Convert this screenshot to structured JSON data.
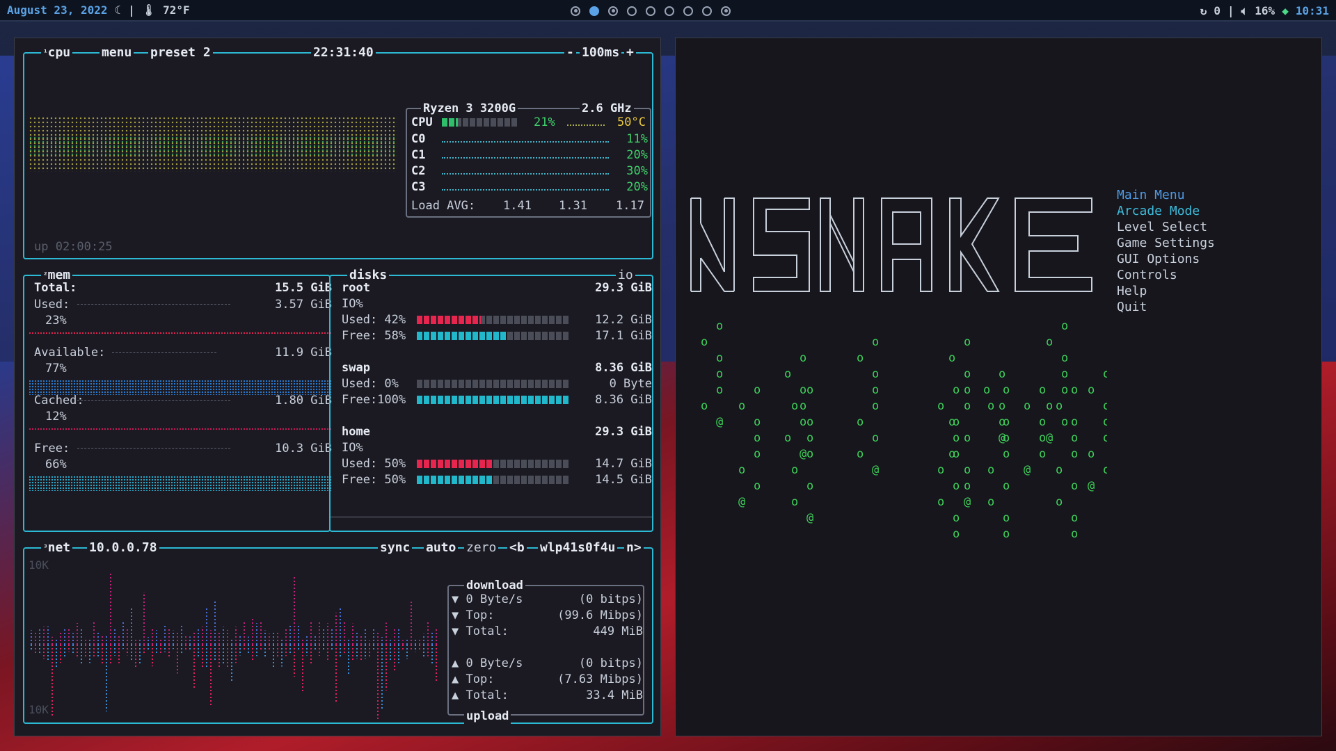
{
  "topbar": {
    "date": "August 23, 2022",
    "moon_icon": "moon-icon",
    "temp_icon": "thermometer-icon",
    "temperature": "72°F",
    "workspaces": [
      {
        "state": "dot"
      },
      {
        "state": "active"
      },
      {
        "state": "dot"
      },
      {
        "state": "empty"
      },
      {
        "state": "empty"
      },
      {
        "state": "empty"
      },
      {
        "state": "empty"
      },
      {
        "state": "empty"
      },
      {
        "state": "dot"
      }
    ],
    "updates_icon": "refresh-icon",
    "updates_count": "0",
    "volume_icon": "speaker-icon",
    "volume": "16%",
    "wifi_icon": "wifi-icon",
    "clock": "10:31"
  },
  "btop": {
    "cpu": {
      "label_num": "¹",
      "label": "cpu",
      "menu": "menu",
      "preset": "preset 2",
      "time": "22:31:40",
      "minus": "-",
      "interval": "100ms",
      "plus": "+",
      "uptime": "up 02:00:25",
      "model": "Ryzen 3 3200G",
      "freq": "2.6 GHz",
      "total": {
        "label": "CPU",
        "percent": "21%",
        "percent_value": 21,
        "temp": "50°C"
      },
      "cores": [
        {
          "label": "C0",
          "percent": "11%"
        },
        {
          "label": "C1",
          "percent": "20%"
        },
        {
          "label": "C2",
          "percent": "30%"
        },
        {
          "label": "C3",
          "percent": "20%"
        }
      ],
      "load_label": "Load AVG:",
      "load": [
        "1.41",
        "1.31",
        "1.17"
      ]
    },
    "mem": {
      "label_num": "²",
      "label": "mem",
      "total_label": "Total:",
      "total": "15.5 GiB",
      "rows": [
        {
          "label": "Used:",
          "value": "3.57 GiB",
          "percent": "23%",
          "color": "#e8254f"
        },
        {
          "label": "Available:",
          "value": "11.9 GiB",
          "percent": "77%",
          "color": "#2a7fd6"
        },
        {
          "label": "Cached:",
          "value": "1.80 GiB",
          "percent": "12%",
          "color": "#d01a5a"
        },
        {
          "label": "Free:",
          "value": "10.3 GiB",
          "percent": "66%",
          "color": "#2ab0d0"
        }
      ]
    },
    "disks": {
      "label": "disks",
      "io": "io",
      "items": [
        {
          "name": "root",
          "size": "29.3 GiB",
          "io": "IO%",
          "used_label": "Used: 42%",
          "used": "12.2 GiB",
          "used_pct": 42,
          "free_label": "Free: 58%",
          "free": "17.1 GiB",
          "free_pct": 58
        },
        {
          "name": "swap",
          "size": "8.36 GiB",
          "io": "",
          "used_label": "Used:  0%",
          "used": "0 Byte",
          "used_pct": 0,
          "free_label": "Free:100%",
          "free": "8.36 GiB",
          "free_pct": 100
        },
        {
          "name": "home",
          "size": "29.3 GiB",
          "io": "IO%",
          "used_label": "Used: 50%",
          "used": "14.7 GiB",
          "used_pct": 50,
          "free_label": "Free: 50%",
          "free": "14.5 GiB",
          "free_pct": 50
        }
      ]
    },
    "net": {
      "label_num": "³",
      "label": "net",
      "ip": "10.0.0.78",
      "sync": "sync",
      "auto": "auto",
      "zero": "zero",
      "prev": "<b",
      "iface": "wlp41s0f4u",
      "next": "n>",
      "scale_top": "10K",
      "scale_bottom": "10K",
      "download_title": "download",
      "upload_title": "upload",
      "down": [
        {
          "arrow": "▼",
          "label": "0 Byte/s",
          "value": "(0 bitps)"
        },
        {
          "arrow": "▼",
          "label": "Top:",
          "value": "(99.6 Mibps)"
        },
        {
          "arrow": "▼",
          "label": "Total:",
          "value": "449 MiB"
        }
      ],
      "up": [
        {
          "arrow": "▲",
          "label": "0 Byte/s",
          "value": "(0 bitps)"
        },
        {
          "arrow": "▲",
          "label": "Top:",
          "value": "(7.63 Mibps)"
        },
        {
          "arrow": "▲",
          "label": "Total:",
          "value": "33.4 MiB"
        }
      ]
    }
  },
  "game": {
    "logo_text": "NSNAKE",
    "menu": [
      {
        "label": "Main Menu",
        "style": "hl1"
      },
      {
        "label": "Arcade Mode",
        "style": "hl2"
      },
      {
        "label": "Level Select",
        "style": ""
      },
      {
        "label": "Game Settings",
        "style": ""
      },
      {
        "label": "GUI Options",
        "style": ""
      },
      {
        "label": "Controls",
        "style": ""
      },
      {
        "label": "Help",
        "style": ""
      },
      {
        "label": "Quit",
        "style": ""
      }
    ]
  }
}
